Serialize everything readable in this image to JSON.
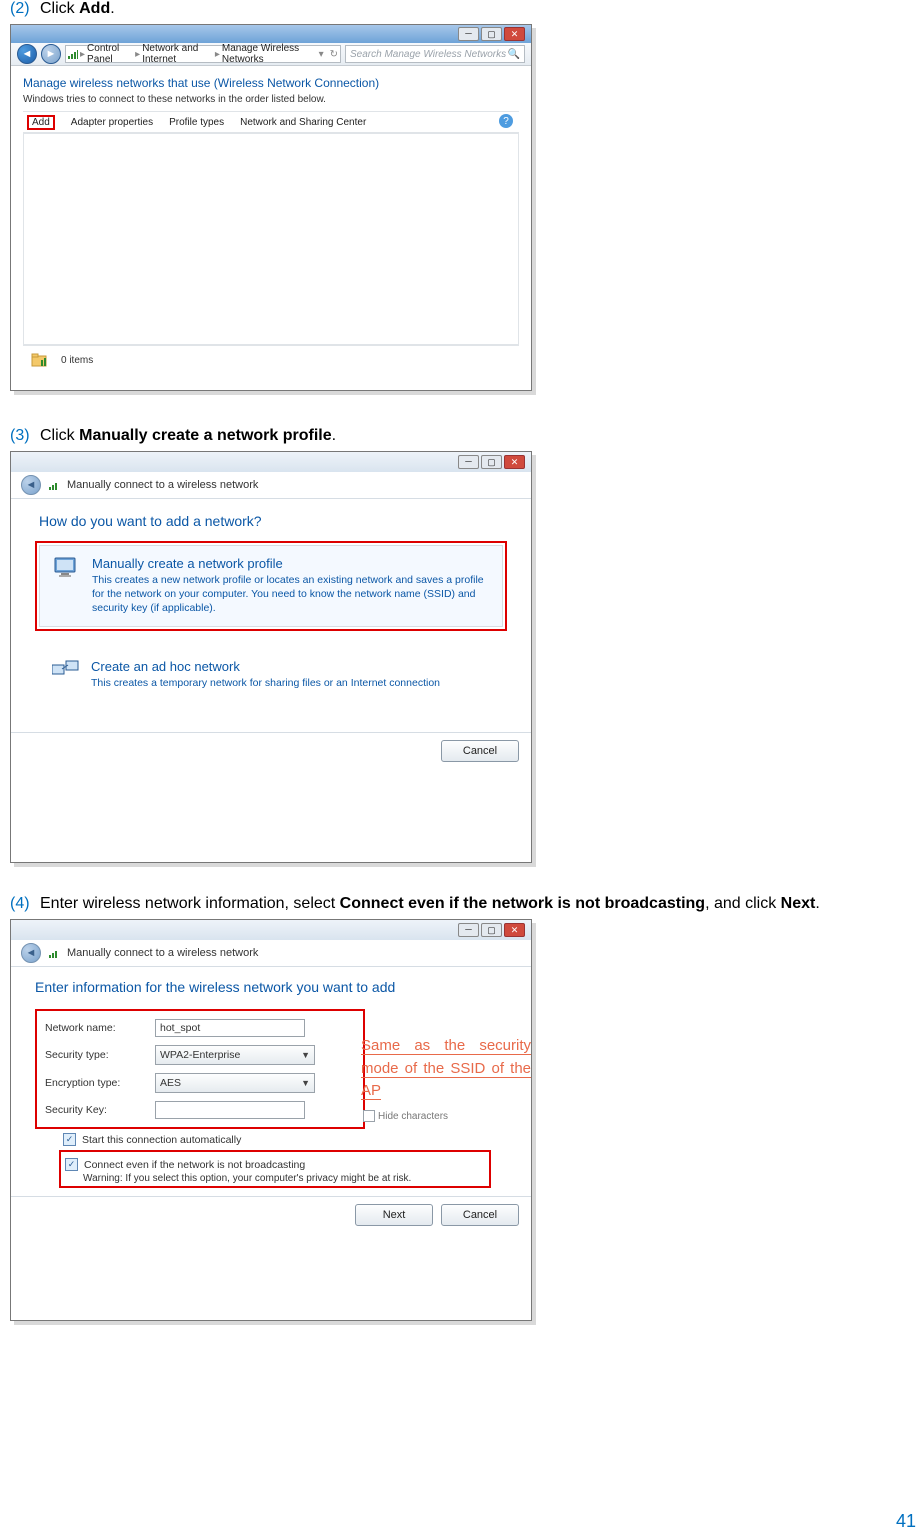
{
  "page_number": "41",
  "steps": {
    "s2": {
      "num": "(2)",
      "pre": "Click ",
      "bold": "Add",
      "post": "."
    },
    "s3": {
      "num": "(3)",
      "pre": "Click ",
      "bold": "Manually create a network profile",
      "post": "."
    },
    "s4": {
      "num": "(4)",
      "pre": "Enter wireless network information, select ",
      "bold1": "Connect even if the network is not broadcasting",
      "mid": ", and click ",
      "bold2": "Next",
      "post": "."
    }
  },
  "shot1": {
    "breadcrumb": {
      "p1": "Control Panel",
      "p2": "Network and Internet",
      "p3": "Manage Wireless Networks"
    },
    "search_placeholder": "Search Manage Wireless Networks",
    "heading": "Manage wireless networks that use (Wireless Network Connection)",
    "subtext": "Windows tries to connect to these networks in the order listed below.",
    "toolbar": {
      "add": "Add",
      "adapter": "Adapter properties",
      "profile": "Profile types",
      "center": "Network and Sharing Center"
    },
    "status": "0 items"
  },
  "shot2": {
    "title": "Manually connect to a wireless network",
    "question": "How do you want to add a network?",
    "opt1": {
      "title": "Manually create a network profile",
      "desc": "This creates a new network profile or locates an existing network and saves a profile for the network on your computer. You need to know the network name (SSID) and security key (if applicable)."
    },
    "opt2": {
      "title": "Create an ad hoc network",
      "desc": "This creates a temporary network for sharing files or an Internet connection"
    },
    "cancel": "Cancel"
  },
  "shot3": {
    "title": "Manually connect to a wireless network",
    "heading": "Enter information for the wireless network you want to add",
    "labels": {
      "name": "Network name:",
      "sectype": "Security type:",
      "enctype": "Encryption type:",
      "seckey": "Security Key:"
    },
    "values": {
      "name": "hot_spot",
      "sectype": "WPA2-Enterprise",
      "enctype": "AES",
      "seckey": ""
    },
    "hide_chars": "Hide characters",
    "chk_auto": "Start this connection automatically",
    "chk_broadcast": "Connect even if the network is not broadcasting",
    "warning": "Warning: If you select this option, your computer's privacy might be at risk.",
    "annotation": "Same as the security mode of the SSID of the AP",
    "next": "Next",
    "cancel": "Cancel"
  }
}
